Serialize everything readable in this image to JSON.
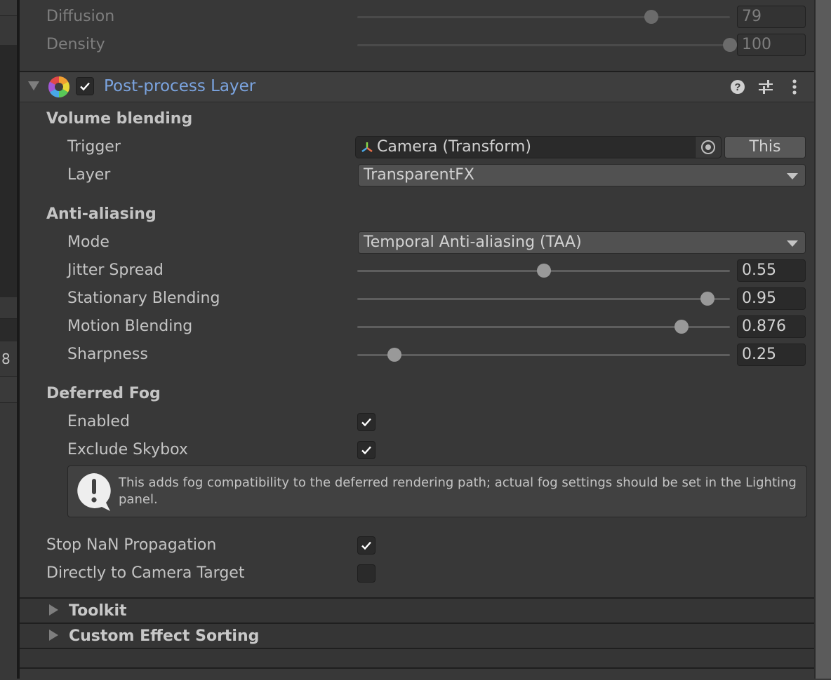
{
  "left_panel": {
    "partial_value": "8"
  },
  "fog_tail": {
    "diffusion": {
      "label": "Diffusion",
      "value": "79",
      "fraction": 0.79
    },
    "density": {
      "label": "Density",
      "value": "100",
      "fraction": 1.0
    }
  },
  "component": {
    "title": "Post-process Layer",
    "enabled": true,
    "title_color": "#7ba4e0",
    "icons": [
      "help-icon",
      "presets-icon",
      "more-menu-icon"
    ]
  },
  "volume_blending": {
    "header": "Volume blending",
    "trigger": {
      "label": "Trigger",
      "value": "Camera (Transform)",
      "this_button": "This"
    },
    "layer": {
      "label": "Layer",
      "value": "TransparentFX"
    }
  },
  "anti_aliasing": {
    "header": "Anti-aliasing",
    "mode": {
      "label": "Mode",
      "value": "Temporal Anti-aliasing (TAA)"
    },
    "sliders": [
      {
        "label": "Jitter Spread",
        "value": "0.55",
        "fraction": 0.5
      },
      {
        "label": "Stationary Blending",
        "value": "0.95",
        "fraction": 0.94
      },
      {
        "label": "Motion Blending",
        "value": "0.876",
        "fraction": 0.87
      },
      {
        "label": "Sharpness",
        "value": "0.25",
        "fraction": 0.1
      }
    ]
  },
  "deferred_fog": {
    "header": "Deferred Fog",
    "enabled": {
      "label": "Enabled",
      "checked": true
    },
    "exclude_skybox": {
      "label": "Exclude Skybox",
      "checked": true
    },
    "help": "This adds fog compatibility to the deferred rendering path; actual fog settings should be set in the Lighting panel."
  },
  "misc": {
    "stop_nan": {
      "label": "Stop NaN Propagation",
      "checked": true
    },
    "direct_to_camera": {
      "label": "Directly to Camera Target",
      "checked": false
    }
  },
  "foldouts": [
    {
      "label": "Toolkit"
    },
    {
      "label": "Custom Effect Sorting"
    }
  ]
}
